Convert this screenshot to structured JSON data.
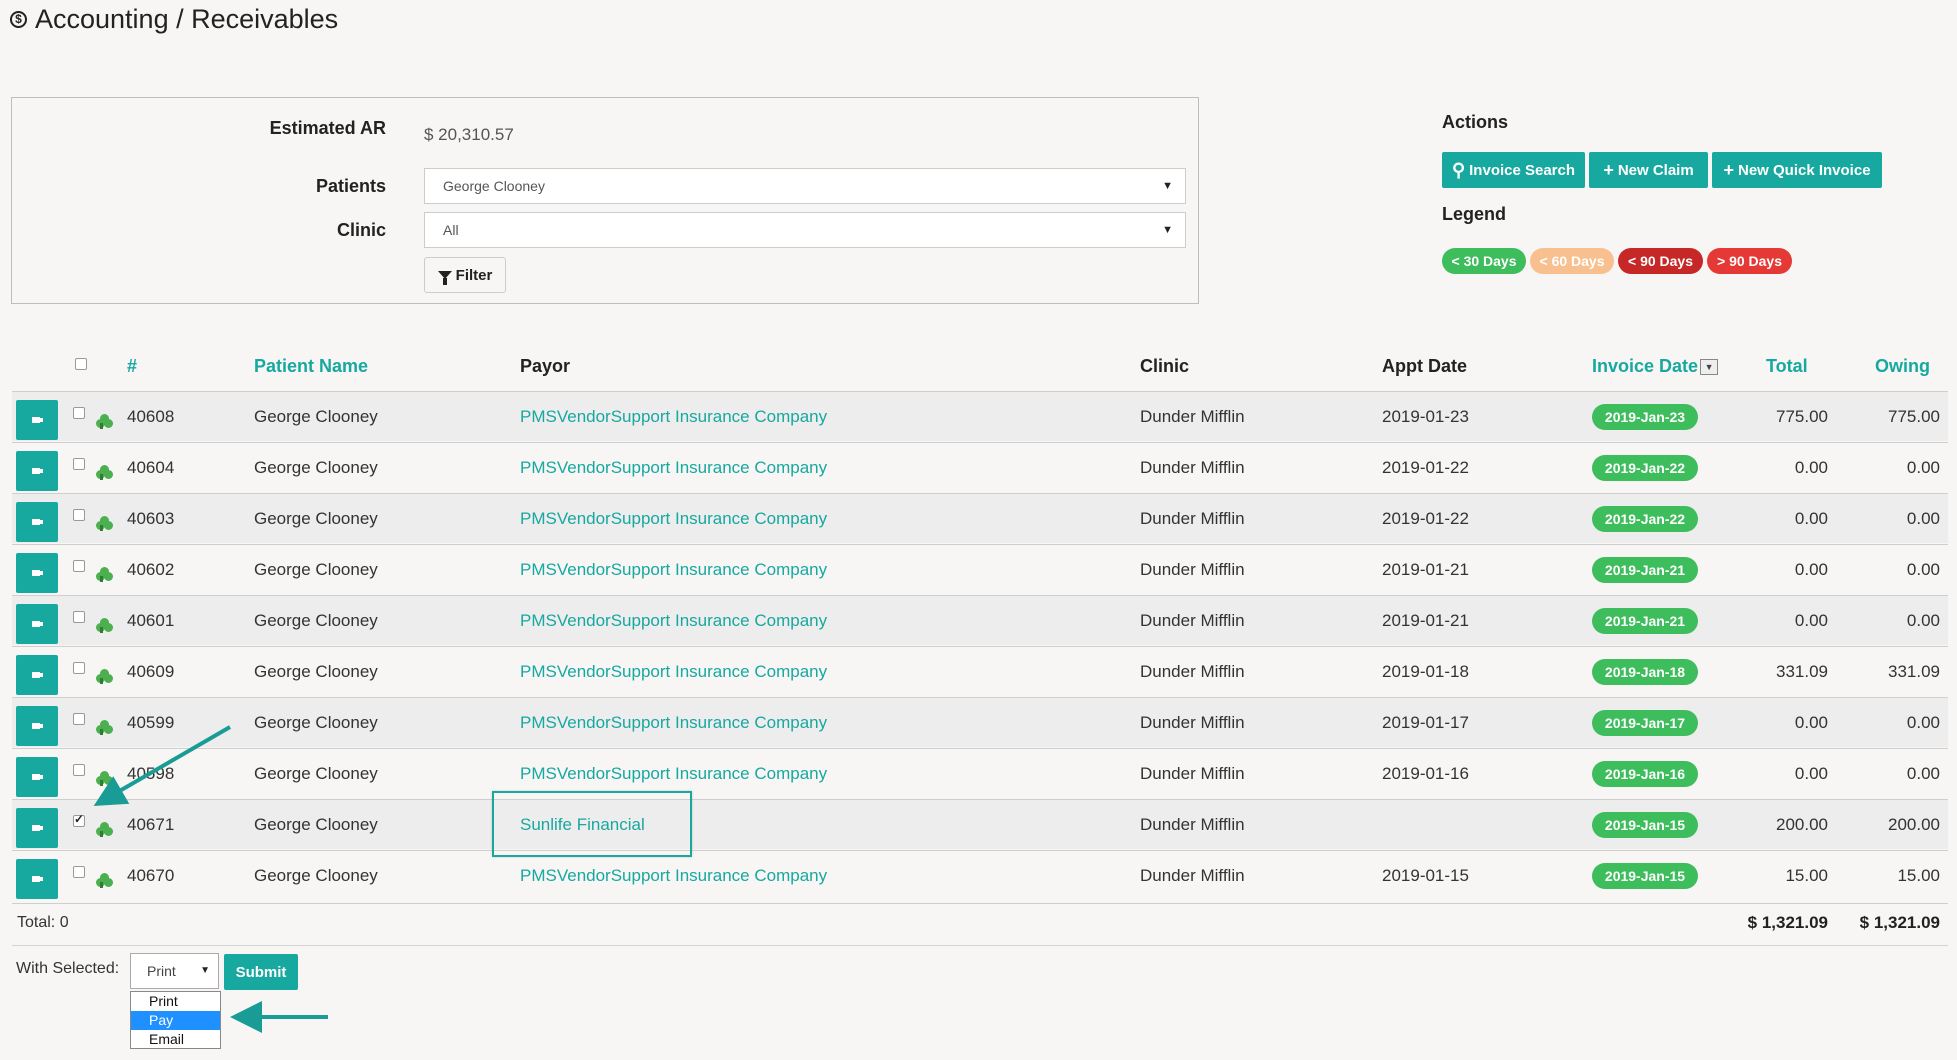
{
  "header": {
    "title": "Accounting / Receivables",
    "icon": "dollar-circle-icon"
  },
  "filters": {
    "estimated_ar_label": "Estimated AR",
    "estimated_ar_value": "$ 20,310.57",
    "patients_label": "Patients",
    "patients_value": "George Clooney",
    "clinic_label": "Clinic",
    "clinic_value": "All",
    "filter_button": "Filter"
  },
  "actions": {
    "label": "Actions",
    "buttons": [
      "Invoice Search",
      "New Claim",
      "New Quick Invoice"
    ]
  },
  "legend": {
    "label": "Legend",
    "items": [
      {
        "label": "< 30 Days",
        "color": "#3dbd5c"
      },
      {
        "label": "< 60 Days",
        "color": "#f9c08f"
      },
      {
        "label": "< 90 Days",
        "color": "#c62828"
      },
      {
        "label": "> 90 Days",
        "color": "#e53935"
      }
    ]
  },
  "table": {
    "columns": {
      "num": "#",
      "patient": "Patient Name",
      "payor": "Payor",
      "clinic": "Clinic",
      "appt": "Appt Date",
      "invoice": "Invoice Date",
      "total": "Total",
      "owing": "Owing"
    },
    "rows": [
      {
        "num": "40608",
        "patient": "George Clooney",
        "payor": "PMSVendorSupport Insurance Company",
        "clinic": "Dunder Mifflin",
        "appt": "2019-01-23",
        "invoice": "2019-Jan-23",
        "total": "775.00",
        "owing": "775.00",
        "checked": false
      },
      {
        "num": "40604",
        "patient": "George Clooney",
        "payor": "PMSVendorSupport Insurance Company",
        "clinic": "Dunder Mifflin",
        "appt": "2019-01-22",
        "invoice": "2019-Jan-22",
        "total": "0.00",
        "owing": "0.00",
        "checked": false
      },
      {
        "num": "40603",
        "patient": "George Clooney",
        "payor": "PMSVendorSupport Insurance Company",
        "clinic": "Dunder Mifflin",
        "appt": "2019-01-22",
        "invoice": "2019-Jan-22",
        "total": "0.00",
        "owing": "0.00",
        "checked": false
      },
      {
        "num": "40602",
        "patient": "George Clooney",
        "payor": "PMSVendorSupport Insurance Company",
        "clinic": "Dunder Mifflin",
        "appt": "2019-01-21",
        "invoice": "2019-Jan-21",
        "total": "0.00",
        "owing": "0.00",
        "checked": false
      },
      {
        "num": "40601",
        "patient": "George Clooney",
        "payor": "PMSVendorSupport Insurance Company",
        "clinic": "Dunder Mifflin",
        "appt": "2019-01-21",
        "invoice": "2019-Jan-21",
        "total": "0.00",
        "owing": "0.00",
        "checked": false
      },
      {
        "num": "40609",
        "patient": "George Clooney",
        "payor": "PMSVendorSupport Insurance Company",
        "clinic": "Dunder Mifflin",
        "appt": "2019-01-18",
        "invoice": "2019-Jan-18",
        "total": "331.09",
        "owing": "331.09",
        "checked": false
      },
      {
        "num": "40599",
        "patient": "George Clooney",
        "payor": "PMSVendorSupport Insurance Company",
        "clinic": "Dunder Mifflin",
        "appt": "2019-01-17",
        "invoice": "2019-Jan-17",
        "total": "0.00",
        "owing": "0.00",
        "checked": false
      },
      {
        "num": "40598",
        "patient": "George Clooney",
        "payor": "PMSVendorSupport Insurance Company",
        "clinic": "Dunder Mifflin",
        "appt": "2019-01-16",
        "invoice": "2019-Jan-16",
        "total": "0.00",
        "owing": "0.00",
        "checked": false
      },
      {
        "num": "40671",
        "patient": "George Clooney",
        "payor": "Sunlife Financial",
        "clinic": "Dunder Mifflin",
        "appt": "",
        "invoice": "2019-Jan-15",
        "total": "200.00",
        "owing": "200.00",
        "checked": true
      },
      {
        "num": "40670",
        "patient": "George Clooney",
        "payor": "PMSVendorSupport Insurance Company",
        "clinic": "Dunder Mifflin",
        "appt": "2019-01-15",
        "invoice": "2019-Jan-15",
        "total": "15.00",
        "owing": "15.00",
        "checked": false
      }
    ],
    "footer": {
      "total_label": "Total: 0",
      "total_sum": "$ 1,321.09",
      "owing_sum": "$ 1,321.09"
    }
  },
  "with_selected": {
    "label": "With Selected:",
    "value": "Print",
    "options": [
      "Print",
      "Pay",
      "Email"
    ],
    "highlighted_option": "Pay",
    "submit": "Submit"
  },
  "accent_color": "#17a8a0"
}
